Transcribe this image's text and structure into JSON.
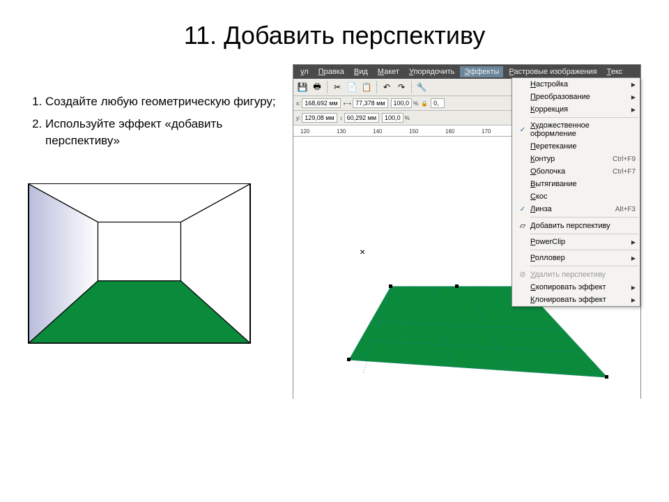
{
  "title": "11. Добавить перспективу",
  "instructions": [
    "Создайте любую геометрическую фигуру;",
    "Используйте эффект «добавить перспективу»"
  ],
  "menubar": {
    "items": [
      "ул",
      "Правка",
      "Вид",
      "Макет",
      "Упорядочить",
      "Эффекты",
      "Растровые изображения",
      "Текс"
    ],
    "active": 5
  },
  "toolbar": {
    "icons": [
      "💾",
      "🖶",
      "|",
      "✂",
      "📄",
      "📋",
      "|",
      "↶",
      "↷",
      "|",
      "🔧"
    ]
  },
  "propbar": {
    "x": "168,692 мм",
    "y": "129,08 мм",
    "w_label": "⟷",
    "w": "77,378 мм",
    "h_label": "↕",
    "h": "60,292 мм",
    "sx": "100,0",
    "sy": "100,0",
    "lock": "🔒",
    "extra": "0,",
    "extra2": "|"
  },
  "ruler": {
    "ticks": [
      "120",
      "130",
      "140",
      "150",
      "160",
      "170"
    ]
  },
  "canvas": {
    "cross": "×"
  },
  "dropdown": [
    {
      "label": "Настройка",
      "submenu": true
    },
    {
      "label": "Преобразование",
      "submenu": true
    },
    {
      "label": "Коррекция",
      "submenu": true
    },
    {
      "sep": true
    },
    {
      "label": "Художественное оформление",
      "check": true
    },
    {
      "label": "Перетекание"
    },
    {
      "label": "Контур",
      "shortcut": "Ctrl+F9"
    },
    {
      "label": "Оболочка",
      "shortcut": "Ctrl+F7"
    },
    {
      "label": "Вытягивание"
    },
    {
      "label": "Скос"
    },
    {
      "label": "Линза",
      "shortcut": "Alt+F3",
      "check": true
    },
    {
      "sep": true
    },
    {
      "label": "Добавить перспективу",
      "icon": "▱"
    },
    {
      "sep": true
    },
    {
      "label": "PowerClip",
      "submenu": true
    },
    {
      "sep": true
    },
    {
      "label": "Ролловер",
      "submenu": true
    },
    {
      "sep": true
    },
    {
      "label": "Удалить перспективу",
      "icon": "⊘",
      "disabled": true
    },
    {
      "label": "Скопировать эффект",
      "submenu": true
    },
    {
      "label": "Клонировать эффект",
      "submenu": true
    }
  ]
}
